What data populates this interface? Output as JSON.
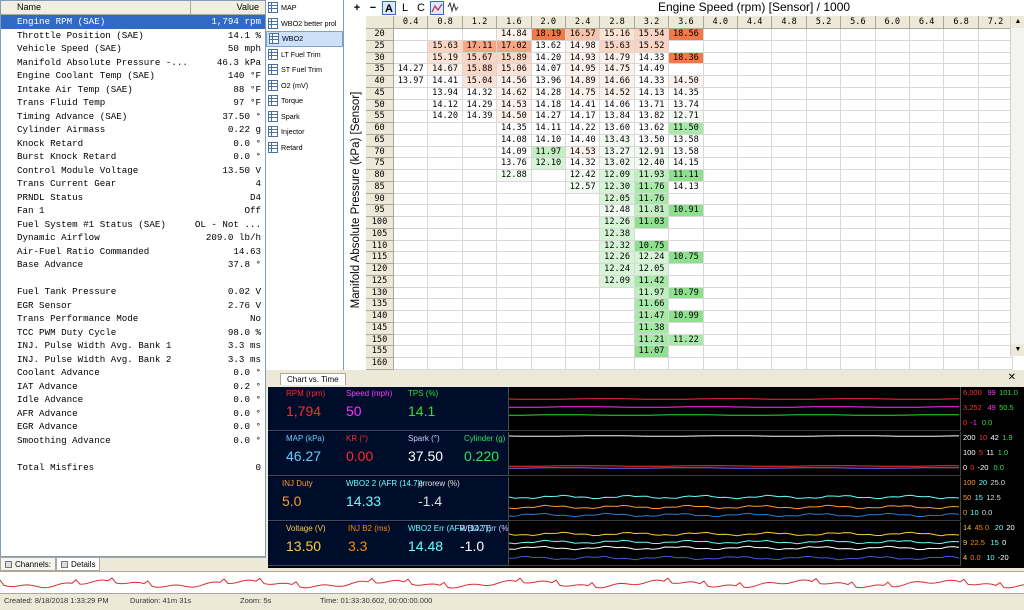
{
  "channels": {
    "header_name": "Name",
    "header_value": "Value",
    "rows": [
      {
        "name": "Engine RPM (SAE)",
        "value": "1,794 rpm"
      },
      {
        "name": "Throttle Position (SAE)",
        "value": "14.1 %"
      },
      {
        "name": "Vehicle Speed (SAE)",
        "value": "50 mph"
      },
      {
        "name": "Manifold Absolute Pressure -...",
        "value": "46.3 kPa"
      },
      {
        "name": "Engine Coolant Temp (SAE)",
        "value": "140 °F"
      },
      {
        "name": "Intake Air Temp (SAE)",
        "value": "88 °F"
      },
      {
        "name": "Trans Fluid Temp",
        "value": "97 °F"
      },
      {
        "name": "Timing Advance (SAE)",
        "value": "37.50 °"
      },
      {
        "name": "Cylinder Airmass",
        "value": "0.22 g"
      },
      {
        "name": "Knock Retard",
        "value": "0.0 °"
      },
      {
        "name": "Burst Knock Retard",
        "value": "0.0 °"
      },
      {
        "name": "Control Module Voltage",
        "value": "13.50 V"
      },
      {
        "name": "Trans Current Gear",
        "value": "4"
      },
      {
        "name": "PRNDL Status",
        "value": "D4"
      },
      {
        "name": "Fan 1",
        "value": "Off"
      },
      {
        "name": "Fuel System #1 Status (SAE)",
        "value": "OL - Not ..."
      },
      {
        "name": "Dynamic Airflow",
        "value": "209.0 lb/h"
      },
      {
        "name": "Air-Fuel Ratio Commanded",
        "value": "14.63"
      },
      {
        "name": "Base Advance",
        "value": "37.8 °"
      },
      {
        "name": "",
        "value": ""
      },
      {
        "name": "Fuel Tank Pressure",
        "value": "0.02 V"
      },
      {
        "name": "EGR Sensor",
        "value": "2.76 V"
      },
      {
        "name": "Trans Performance Mode",
        "value": "No"
      },
      {
        "name": "TCC PWM Duty Cycle",
        "value": "98.0 %"
      },
      {
        "name": "INJ. Pulse Width Avg. Bank 1",
        "value": "3.3 ms"
      },
      {
        "name": "INJ. Pulse Width Avg. Bank 2",
        "value": "3.3 ms"
      },
      {
        "name": "Coolant Advance",
        "value": "0.0 °"
      },
      {
        "name": "IAT Advance",
        "value": "0.2 °"
      },
      {
        "name": "Idle Advance",
        "value": "0.0 °"
      },
      {
        "name": "AFR Advance",
        "value": "0.0 °"
      },
      {
        "name": "EGR Advance",
        "value": "0.0 °"
      },
      {
        "name": "Smoothing Advance",
        "value": "0.0 °"
      },
      {
        "name": "",
        "value": ""
      },
      {
        "name": "Total Misfires",
        "value": "0"
      }
    ]
  },
  "left_tabs": {
    "channels": "Channels:",
    "details": "Details"
  },
  "table_list": {
    "items": [
      "MAP",
      "WBO2 better prol",
      "WBO2",
      "LT Fuel Trim",
      "ST Fuel Trim",
      "O2 (mV)",
      "Torque",
      "Spark",
      "Injector",
      "Retard"
    ],
    "selected": "WBO2"
  },
  "toolbar": {
    "plus": "+",
    "minus": "−",
    "a": "A",
    "l": "L",
    "c": "C"
  },
  "table": {
    "x_title": "Engine Speed (rpm) [Sensor] / 1000",
    "y_title": "Manifold Absolute Pressure (kPa) [Sensor]",
    "cols": [
      "0.4",
      "0.8",
      "1.2",
      "1.6",
      "2.0",
      "2.4",
      "2.8",
      "3.2",
      "3.6",
      "4.0",
      "4.4",
      "4.8",
      "5.2",
      "5.6",
      "6.0",
      "6.4",
      "6.8",
      "7.2"
    ],
    "rows": [
      "20",
      "25",
      "30",
      "35",
      "40",
      "45",
      "50",
      "55",
      "60",
      "65",
      "70",
      "75",
      "80",
      "85",
      "90",
      "95",
      "100",
      "105",
      "110",
      "115",
      "120",
      "125",
      "130",
      "135",
      "140",
      "145",
      "150",
      "155",
      "160"
    ],
    "values": [
      [
        null,
        null,
        null,
        "14.84",
        "18.19",
        "16.57",
        "15.16",
        "15.54",
        "18.56"
      ],
      [
        null,
        "15.63",
        "17.11",
        "17.02",
        "13.62",
        "14.98",
        "15.63",
        "15.52",
        null
      ],
      [
        null,
        "15.19",
        "15.67",
        "15.89",
        "14.20",
        "14.93",
        "14.79",
        "14.33",
        "18.36"
      ],
      [
        "14.27",
        "14.67",
        "15.88",
        "15.06",
        "14.07",
        "14.95",
        "14.75",
        "14.49",
        null
      ],
      [
        "13.97",
        "14.41",
        "15.04",
        "14.56",
        "13.96",
        "14.89",
        "14.66",
        "14.33",
        "14.50"
      ],
      [
        null,
        "13.94",
        "14.32",
        "14.62",
        "14.28",
        "14.75",
        "14.52",
        "14.13",
        "14.35"
      ],
      [
        null,
        "14.12",
        "14.29",
        "14.53",
        "14.18",
        "14.41",
        "14.06",
        "13.71",
        "13.74"
      ],
      [
        null,
        "14.20",
        "14.39",
        "14.50",
        "14.27",
        "14.17",
        "13.84",
        "13.82",
        "12.71"
      ],
      [
        null,
        null,
        null,
        "14.35",
        "14.11",
        "14.22",
        "13.60",
        "13.62",
        "11.50"
      ],
      [
        null,
        null,
        null,
        "14.08",
        "14.10",
        "14.40",
        "13.43",
        "13.50",
        "13.58"
      ],
      [
        null,
        null,
        null,
        "14.09",
        "11.97",
        "14.53",
        "13.27",
        "12.91",
        "13.58"
      ],
      [
        null,
        null,
        null,
        "13.76",
        "12.10",
        "14.32",
        "13.02",
        "12.40",
        "14.15"
      ],
      [
        null,
        null,
        null,
        "12.88",
        null,
        "12.42",
        "12.09",
        "11.93",
        "11.11"
      ],
      [
        null,
        null,
        null,
        null,
        null,
        "12.57",
        "12.30",
        "11.76",
        "14.13"
      ],
      [
        null,
        null,
        null,
        null,
        null,
        null,
        "12.05",
        "11.76",
        null
      ],
      [
        null,
        null,
        null,
        null,
        null,
        null,
        "12.48",
        "11.81",
        "10.91"
      ],
      [
        null,
        null,
        null,
        null,
        null,
        null,
        "12.26",
        "11.03",
        null
      ],
      [
        null,
        null,
        null,
        null,
        null,
        null,
        "12.38",
        null,
        null
      ],
      [
        null,
        null,
        null,
        null,
        null,
        null,
        "12.32",
        "10.75",
        null
      ],
      [
        null,
        null,
        null,
        null,
        null,
        null,
        "12.26",
        "12.24",
        "10.75"
      ],
      [
        null,
        null,
        null,
        null,
        null,
        null,
        "12.24",
        "12.05",
        null
      ],
      [
        null,
        null,
        null,
        null,
        null,
        null,
        "12.09",
        "11.42",
        null
      ],
      [
        null,
        null,
        null,
        null,
        null,
        null,
        null,
        "11.97",
        "10.79"
      ],
      [
        null,
        null,
        null,
        null,
        null,
        null,
        null,
        "11.66",
        null
      ],
      [
        null,
        null,
        null,
        null,
        null,
        null,
        null,
        "11.47",
        "10.99"
      ],
      [
        null,
        null,
        null,
        null,
        null,
        null,
        null,
        "11.38",
        null
      ],
      [
        null,
        null,
        null,
        null,
        null,
        null,
        null,
        "11.21",
        "11.22"
      ],
      [
        null,
        null,
        null,
        null,
        null,
        null,
        null,
        "11.07",
        null
      ],
      [
        null,
        null,
        null,
        null,
        null,
        null,
        null,
        null,
        null
      ]
    ]
  },
  "chart": {
    "tab": "Chart vs. Time",
    "close": "✕",
    "panels": [
      {
        "gauges": [
          {
            "label": "RPM (rpm)",
            "value": "1,794",
            "color": "#ff2a2a"
          },
          {
            "label": "Speed (mph)",
            "value": "50",
            "color": "#ff33ff"
          },
          {
            "label": "TPS (%)",
            "value": "14.1",
            "color": "#33dd33"
          }
        ],
        "scales": [
          [
            "6,000",
            "99",
            "101.0"
          ],
          [
            "3,252",
            "49",
            "50.5"
          ],
          [
            "0",
            "-1",
            "0.0"
          ]
        ],
        "scale_colors": [
          "#ff3030",
          "#ff33ff",
          "#33dd33"
        ]
      },
      {
        "gauges": [
          {
            "label": "MAP (kPa)",
            "value": "46.27",
            "color": "#66ccff"
          },
          {
            "label": "KR (°)",
            "value": "0.00",
            "color": "#ff2a2a"
          },
          {
            "label": "Spark (°)",
            "value": "37.50",
            "color": "#ffffff"
          },
          {
            "label": "Cylinder (g)",
            "value": "0.220",
            "color": "#33dd66"
          }
        ],
        "scales": [
          [
            "200",
            "10",
            "42",
            "1.9"
          ],
          [
            "100",
            "5",
            "11",
            "1.0"
          ],
          [
            "0",
            "0",
            "-20",
            "0.0"
          ]
        ],
        "scale_colors": [
          "#ffffff",
          "#ff3030",
          "#ffffff",
          "#33dd66"
        ]
      },
      {
        "gauges": [
          {
            "label": "INJ Duty",
            "value": "5.0",
            "color": "#ff9933"
          },
          {
            "label": "WBO2 2 (AFR (14.7))",
            "value": "14.33",
            "color": "#66ffff"
          },
          {
            "label": "errorew (%)",
            "value": "-1.4",
            "color": "#dddddd"
          }
        ],
        "scales": [
          [
            "100",
            "20",
            "25.0"
          ],
          [
            "50",
            "15",
            "12.5"
          ],
          [
            "0",
            "10",
            "0.0"
          ]
        ],
        "scale_colors": [
          "#ff9933",
          "#66ffff",
          "#dddddd"
        ]
      },
      {
        "gauges": [
          {
            "label": "Voltage (V)",
            "value": "13.50",
            "color": "#ffcc33"
          },
          {
            "label": "INJ B2 (ms)",
            "value": "3.3",
            "color": "#ff8800"
          },
          {
            "label": "WBO2 Err (AFR (14.7))",
            "value": "14.48",
            "color": "#66ffff"
          },
          {
            "label": "WBO2 Err (%)",
            "value": "-1.0",
            "color": "#ffffff"
          }
        ],
        "scales": [
          [
            "14",
            "45.0",
            "20",
            "20"
          ],
          [
            "9",
            "22.5",
            "15",
            "0"
          ],
          [
            "4",
            "0.0",
            "10",
            "-20"
          ]
        ],
        "scale_colors": [
          "#ffcc33",
          "#ff8800",
          "#66ffff",
          "#ffffff"
        ]
      }
    ]
  },
  "status": {
    "created": "Created: 8/18/2018 1:33:29 PM",
    "duration": "Duration: 41m 31s",
    "zoom": "Zoom: 5s",
    "time": "Time: 01:33:30.602, 00:00:00.000"
  }
}
